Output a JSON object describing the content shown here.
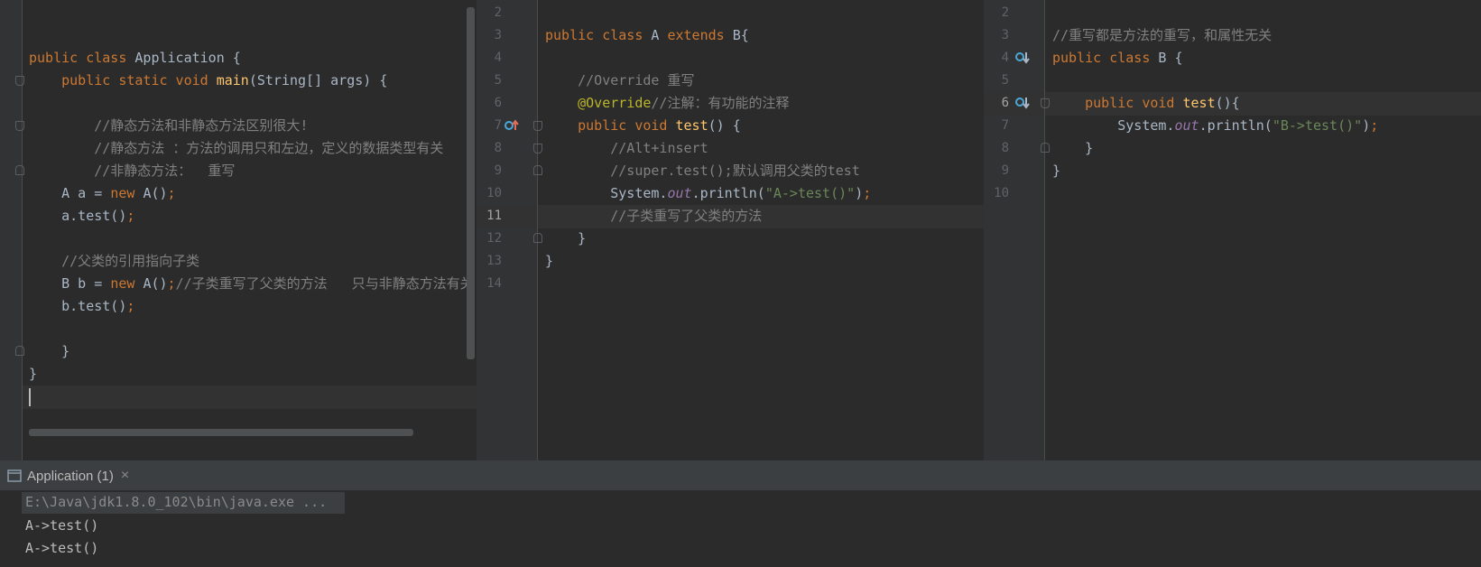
{
  "left_pane": {
    "lines": [
      {
        "html_id": "l1",
        "parts": [
          [
            "kw",
            "public class "
          ],
          [
            "",
            "Application {"
          ]
        ]
      },
      {
        "html_id": "l2",
        "parts": [
          [
            "",
            "    "
          ],
          [
            "kw",
            "public static void "
          ],
          [
            "fn",
            "main"
          ],
          [
            "",
            "(String[] args) {"
          ]
        ]
      },
      {
        "html_id": "l3",
        "parts": []
      },
      {
        "html_id": "l4",
        "parts": [
          [
            "",
            "        "
          ],
          [
            "cm",
            "//静态方法和非静态方法区别很大!"
          ]
        ]
      },
      {
        "html_id": "l5",
        "parts": [
          [
            "",
            "        "
          ],
          [
            "cm",
            "//静态方法 ：方法的调用只和左边，定义的数据类型有关"
          ]
        ]
      },
      {
        "html_id": "l6",
        "parts": [
          [
            "",
            "        "
          ],
          [
            "cm",
            "//非静态方法：  重写"
          ]
        ]
      },
      {
        "html_id": "l7",
        "parts": [
          [
            "",
            "    A a = "
          ],
          [
            "kw",
            "new "
          ],
          [
            "",
            "A()"
          ],
          [
            "kw",
            ";"
          ]
        ]
      },
      {
        "html_id": "l8",
        "parts": [
          [
            "",
            "    a.test()"
          ],
          [
            "kw",
            ";"
          ]
        ]
      },
      {
        "html_id": "l9",
        "parts": []
      },
      {
        "html_id": "l10",
        "parts": [
          [
            "",
            "    "
          ],
          [
            "cm",
            "//父类的引用指向子类"
          ]
        ]
      },
      {
        "html_id": "l11",
        "parts": [
          [
            "",
            "    B b = "
          ],
          [
            "kw",
            "new "
          ],
          [
            "",
            "A()"
          ],
          [
            "kw",
            ";"
          ],
          [
            "cm",
            "//子类重写了父类的方法   只与非静态方法有关"
          ]
        ]
      },
      {
        "html_id": "l12",
        "parts": [
          [
            "",
            "    b.test()"
          ],
          [
            "kw",
            ";"
          ]
        ]
      },
      {
        "html_id": "l13",
        "parts": []
      },
      {
        "html_id": "l14",
        "parts": [
          [
            "",
            "    }"
          ]
        ]
      },
      {
        "html_id": "l15",
        "parts": [
          [
            "",
            "}"
          ]
        ]
      }
    ]
  },
  "middle_pane": {
    "line_numbers": [
      "2",
      "3",
      "4",
      "5",
      "6",
      "7",
      "8",
      "9",
      "10",
      "11",
      "12",
      "13",
      "14"
    ],
    "current_line": "11",
    "lines": [
      {
        "parts": []
      },
      {
        "parts": [
          [
            "kw",
            "public class "
          ],
          [
            "",
            "A "
          ],
          [
            "kw",
            "extends "
          ],
          [
            "",
            "B{"
          ]
        ]
      },
      {
        "parts": []
      },
      {
        "parts": [
          [
            "",
            "    "
          ],
          [
            "cm",
            "//Override 重写"
          ]
        ]
      },
      {
        "parts": [
          [
            "",
            "    "
          ],
          [
            "ann",
            "@Override"
          ],
          [
            "cm",
            "//注解：有功能的注释"
          ]
        ]
      },
      {
        "parts": [
          [
            "",
            "    "
          ],
          [
            "kw",
            "public void "
          ],
          [
            "fn",
            "test"
          ],
          [
            "",
            "() {"
          ]
        ]
      },
      {
        "parts": [
          [
            "",
            "        "
          ],
          [
            "cm",
            "//Alt+insert"
          ]
        ]
      },
      {
        "parts": [
          [
            "",
            "        "
          ],
          [
            "cm",
            "//super.test();默认调用父类的test"
          ]
        ]
      },
      {
        "parts": [
          [
            "",
            "        System."
          ],
          [
            "fld",
            "out"
          ],
          [
            "",
            ".println("
          ],
          [
            "str",
            "\"A->test()\""
          ],
          [
            "",
            ")"
          ],
          [
            "kw",
            ";"
          ]
        ]
      },
      {
        "parts": [
          [
            "",
            "        "
          ],
          [
            "cm",
            "//子类重写了父类的方法"
          ]
        ]
      },
      {
        "parts": [
          [
            "",
            "    }"
          ]
        ]
      },
      {
        "parts": [
          [
            "",
            "}"
          ]
        ]
      },
      {
        "parts": []
      }
    ]
  },
  "right_pane": {
    "line_numbers": [
      "2",
      "3",
      "4",
      "5",
      "6",
      "7",
      "8",
      "9",
      "10"
    ],
    "current_line": "6",
    "lines": [
      {
        "parts": []
      },
      {
        "parts": [
          [
            "cm",
            "//重写都是方法的重写，和属性无关"
          ]
        ]
      },
      {
        "parts": [
          [
            "kw",
            "public class "
          ],
          [
            "",
            "B {"
          ]
        ]
      },
      {
        "parts": []
      },
      {
        "parts": [
          [
            "",
            "    "
          ],
          [
            "kw",
            "public void "
          ],
          [
            "fn",
            "test"
          ],
          [
            "",
            "(){"
          ]
        ]
      },
      {
        "parts": [
          [
            "",
            "        System."
          ],
          [
            "fld",
            "out"
          ],
          [
            "",
            ".println("
          ],
          [
            "str",
            "\"B->test()\""
          ],
          [
            "",
            ")"
          ],
          [
            "kw",
            ";"
          ]
        ]
      },
      {
        "parts": [
          [
            "",
            "    }"
          ]
        ]
      },
      {
        "parts": [
          [
            "",
            "}"
          ]
        ]
      },
      {
        "parts": []
      }
    ]
  },
  "run_panel": {
    "tab_label": "Application (1)",
    "close_symbol": "×",
    "output": [
      "E:\\Java\\jdk1.8.0_102\\bin\\java.exe ...",
      "A->test()",
      "A->test()"
    ]
  },
  "colors": {
    "editor_bg": "#2b2b2b",
    "keyword": "#cc7832",
    "method": "#ffc66d",
    "comment": "#808080",
    "string": "#6a8759",
    "annotation": "#bbb529",
    "field": "#9876aa"
  },
  "icons": {
    "override_up": "override-arrow-up-icon",
    "implemented_down": "implemented-arrow-down-icon",
    "fold": "fold-marker-icon",
    "run_tab": "run-console-icon"
  }
}
